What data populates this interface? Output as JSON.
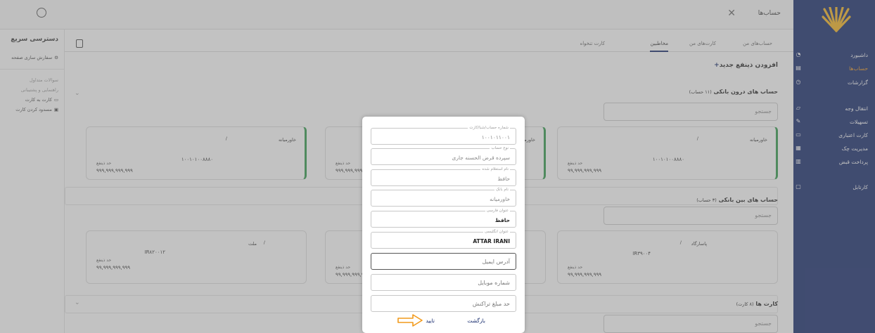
{
  "topbar": {
    "title": "حساب‌ها",
    "close_icon": "close-icon",
    "user_icon": "user-icon"
  },
  "sidebar": {
    "items": [
      {
        "label": "داشبورد",
        "icon": "dashboard-icon"
      },
      {
        "label": "حساب‌ها",
        "icon": "wallet-icon",
        "active": true
      },
      {
        "label": "گزارشات",
        "icon": "clock-icon"
      },
      {
        "label": "انتقال وجه",
        "icon": "transfer-icon"
      },
      {
        "label": "تسهیلات",
        "icon": "edit-icon"
      },
      {
        "label": "کارت اعتباری",
        "icon": "card-icon"
      },
      {
        "label": "مدیریت چک",
        "icon": "cheque-icon"
      },
      {
        "label": "پرداخت قبض",
        "icon": "bill-icon"
      },
      {
        "label": "کارتابل",
        "icon": "folder-icon"
      }
    ],
    "accent": "#f29a1c",
    "bg": "#13286b"
  },
  "quick": {
    "title": "دسترسی سریع",
    "customize": "سفارش سازی صفحه",
    "faq": "سوالات متداول",
    "guide": "راهنمایی و پشتیبانی",
    "card_to_card": "کارت به کارت",
    "block_card": "مسدود کردن کارت"
  },
  "tabs": [
    "حساب‌های من",
    "کارت‌های من",
    "مخاطبین",
    "کارت تنخواه"
  ],
  "main": {
    "add_beneficiary": "افزودن ذینفع جدید",
    "inner_title": "حساب های درون بانکی",
    "inner_count": "(۱۱ حساب)",
    "inter_title": "حساب های بین بانکی",
    "inter_count": "(۳ حساب)",
    "cards_title": "کارت ها",
    "cards_count": "(۸ کارت)",
    "search": "جستجو",
    "limit_label": "حد ذینفع",
    "cards_row1": [
      {
        "bank": "خاورمیانه",
        "slash": "/",
        "num": "۱۰۰۱۰۱۰۰۸۸۸۰",
        "limit": "۹۹,۹۹۹,۹۹۹,۹۹۹"
      },
      {
        "bank": "خاورمیانه",
        "slash": "/",
        "num": "",
        "limit": "۹۹۹,۹۹۹,۹۹۹,۹۹۹"
      },
      {
        "bank": "خاورمیانه",
        "slash": "/",
        "num": "۱۰۰۱۰۱۰۰۸۸۸۰",
        "limit": "۹۹۹,۹۹۹,۹۹۹,۹۹۹"
      }
    ],
    "cards_row2": [
      {
        "bank": "پاسارگاد",
        "slash": "/",
        "num": "IR۳۹۰۰۴",
        "limit": "۹۹,۹۹۹,۹۹۹,۹۹۹"
      },
      {
        "bank": "",
        "slash": "",
        "num": "",
        "limit": "۹۹,۹۹۹,۹۹۹,۹۹۹"
      },
      {
        "bank": "ملت",
        "slash": "/",
        "num": "IR۸۲۰۰۱۲",
        "limit": "۹۹,۹۹۹,۹۹۹,۹۹۹"
      }
    ]
  },
  "modal": {
    "fields": [
      {
        "legend": "شماره حساب/شبا/کارت",
        "value": "۱۰۰۱۰۱۱۰۰۱"
      },
      {
        "legend": "نوع حساب",
        "value": "سپرده قرض الحسنه جاری"
      },
      {
        "legend": "نام استعلام شده",
        "value": "حافظ"
      },
      {
        "legend": "نام بانک",
        "value": "خاورمیانه"
      },
      {
        "legend": "عنوان فارسی",
        "value": "حافظ"
      },
      {
        "legend": "عنوان انگلیسی",
        "value": "ATTAR IRANI"
      }
    ],
    "email_placeholder": "آدرس ایمیل",
    "mobile_placeholder": "شماره موبایل",
    "limit_placeholder": "حد مبلغ تراکنش",
    "back": "بازگشت",
    "confirm": "تایید",
    "arrow_color": "#f29a1c"
  }
}
